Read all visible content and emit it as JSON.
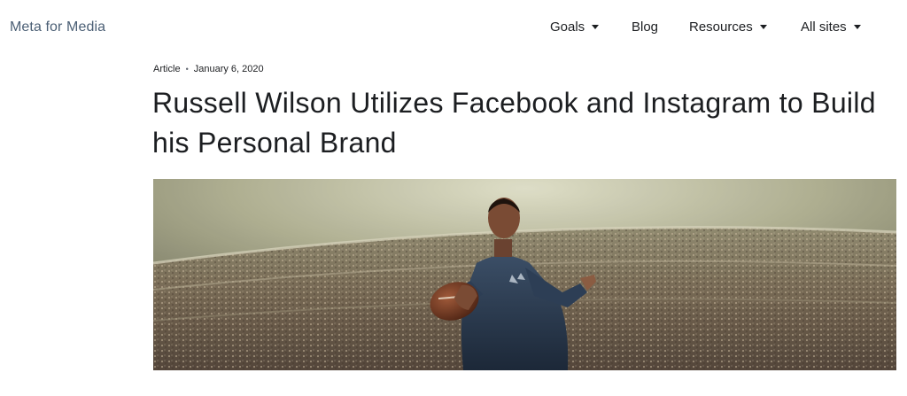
{
  "header": {
    "brand": "Meta for Media",
    "nav": [
      {
        "label": "Goals",
        "has_dropdown": true
      },
      {
        "label": "Blog",
        "has_dropdown": false
      },
      {
        "label": "Resources",
        "has_dropdown": true
      },
      {
        "label": "All sites",
        "has_dropdown": true
      }
    ]
  },
  "article": {
    "type": "Article",
    "date": "January 6, 2020",
    "title": "Russell Wilson Utilizes Facebook and Instagram to Build his Personal Brand"
  },
  "hero_image": {
    "subject": "football-quarterback-in-stadium"
  },
  "colors": {
    "brand_text": "#4b5f75",
    "body_text": "#1c1e21"
  }
}
